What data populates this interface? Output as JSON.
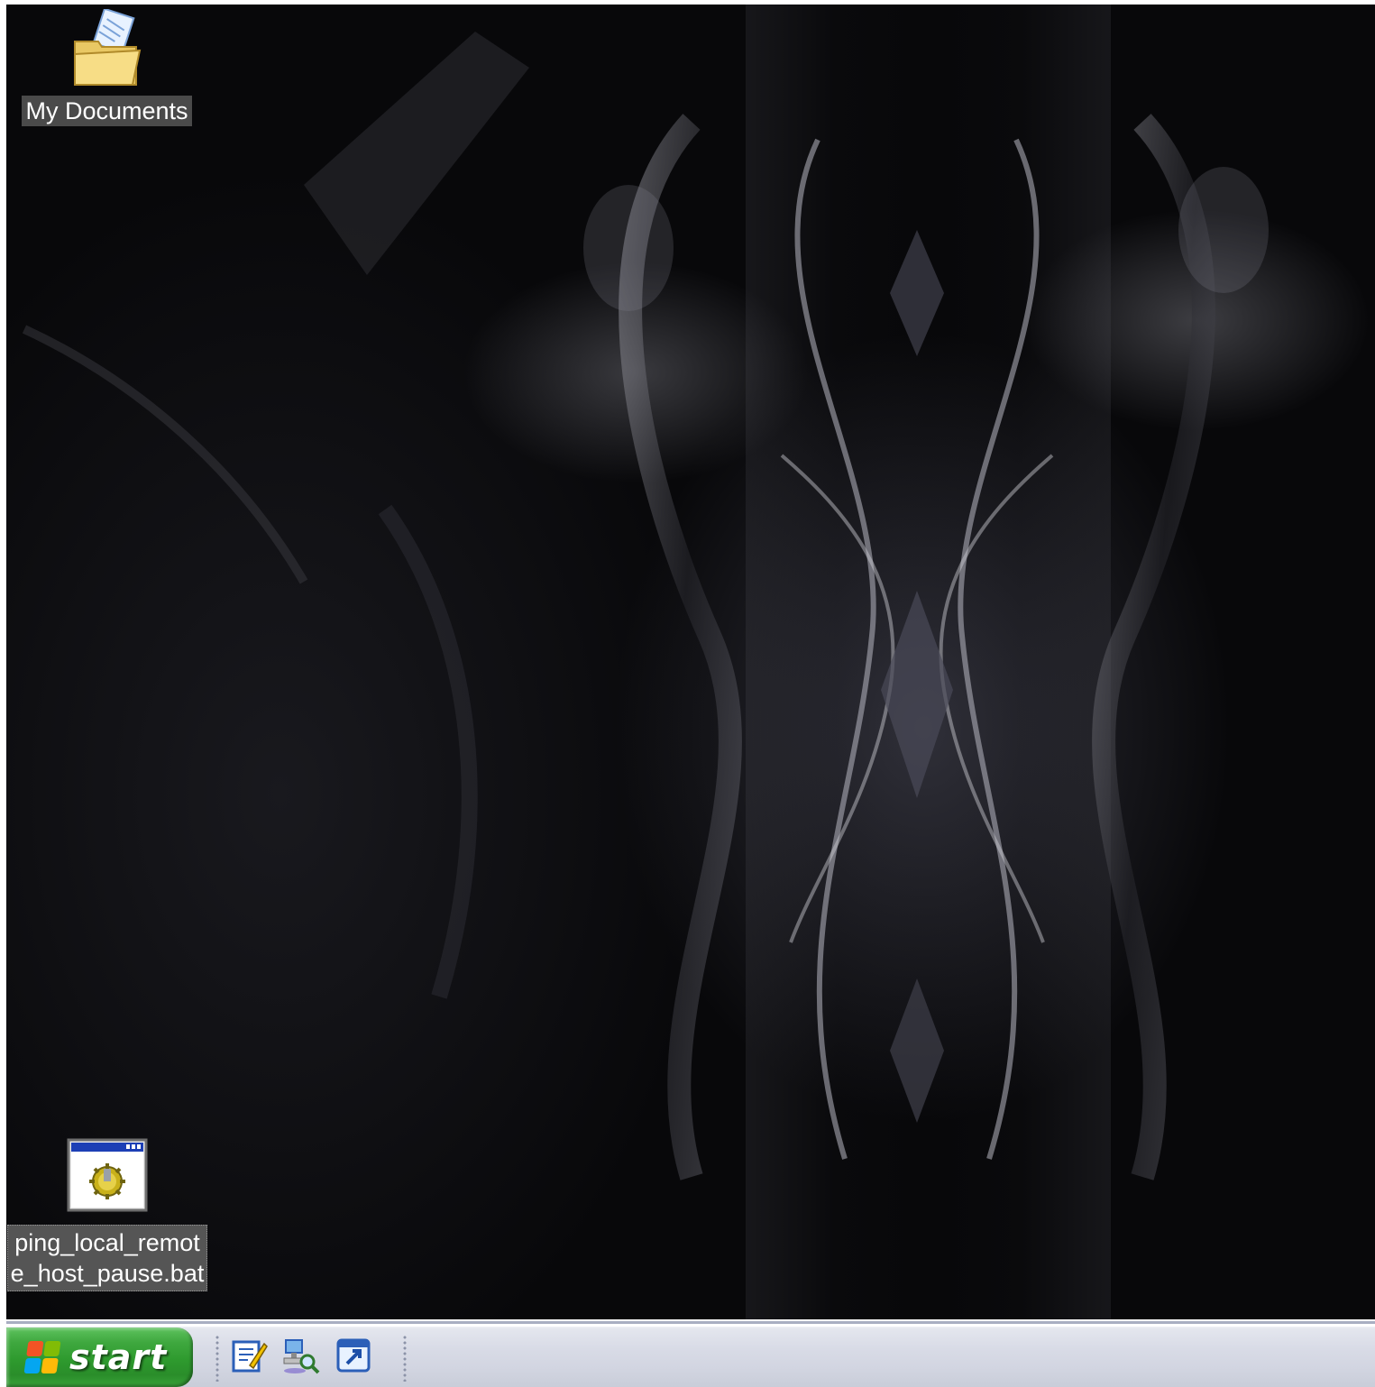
{
  "desktop": {
    "icons": [
      {
        "label": "My Documents",
        "icon": "my-documents-folder-icon"
      },
      {
        "label": "ping_local_remote_host_pause.bat",
        "icon": "batch-file-icon"
      }
    ]
  },
  "taskbar": {
    "start_label": "start",
    "quick_launch": [
      {
        "icon": "notepad-edit-icon"
      },
      {
        "icon": "network-search-icon"
      },
      {
        "icon": "application-launch-icon"
      }
    ]
  },
  "colors": {
    "start_green": "#3fa83f",
    "taskbar_bg": "#d8dbe6",
    "icon_label_bg": "#4a4a4a"
  }
}
